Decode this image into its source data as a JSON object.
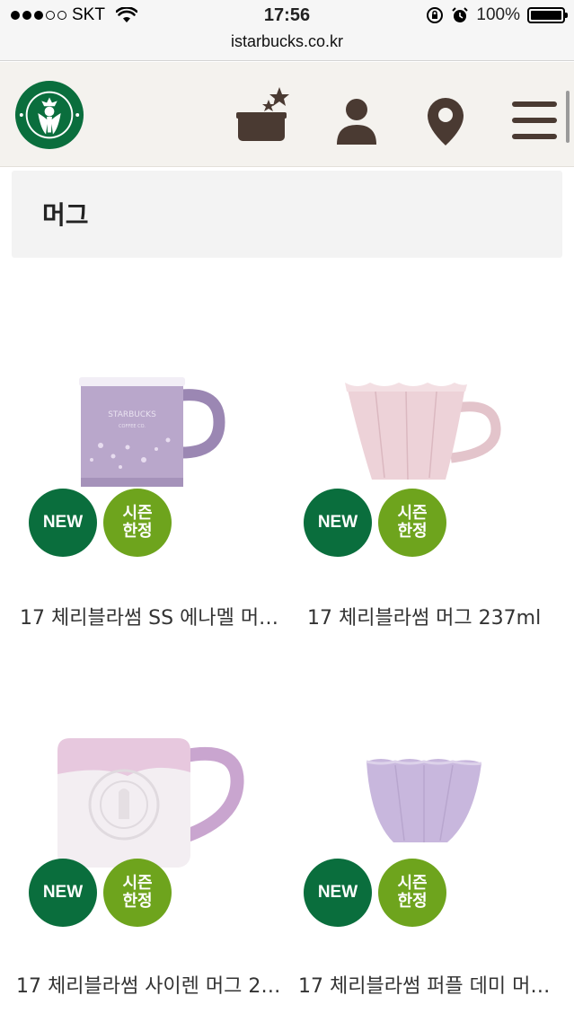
{
  "status_bar": {
    "carrier": "SKT",
    "time": "17:56",
    "battery": "100%",
    "url": "istarbucks.co.kr"
  },
  "header": {
    "logo": "starbucks-siren-logo",
    "icons": [
      "star-gift-icon",
      "user-icon",
      "location-pin-icon",
      "menu-icon"
    ]
  },
  "category": {
    "title": "머그"
  },
  "badges": {
    "new": "NEW",
    "season_line1": "시즌",
    "season_line2": "한정"
  },
  "products": [
    {
      "name": "17 체리블라썸 SS 에나멜 머…"
    },
    {
      "name": "17 체리블라썸 머그 237ml"
    },
    {
      "name": "17 체리블라썸 사이렌 머그 2…"
    },
    {
      "name": "17 체리블라썸 퍼플 데미 머…"
    }
  ],
  "colors": {
    "brand_green": "#0a6e3d",
    "season_green": "#6ea41d",
    "icon_brown": "#4a3a32"
  }
}
